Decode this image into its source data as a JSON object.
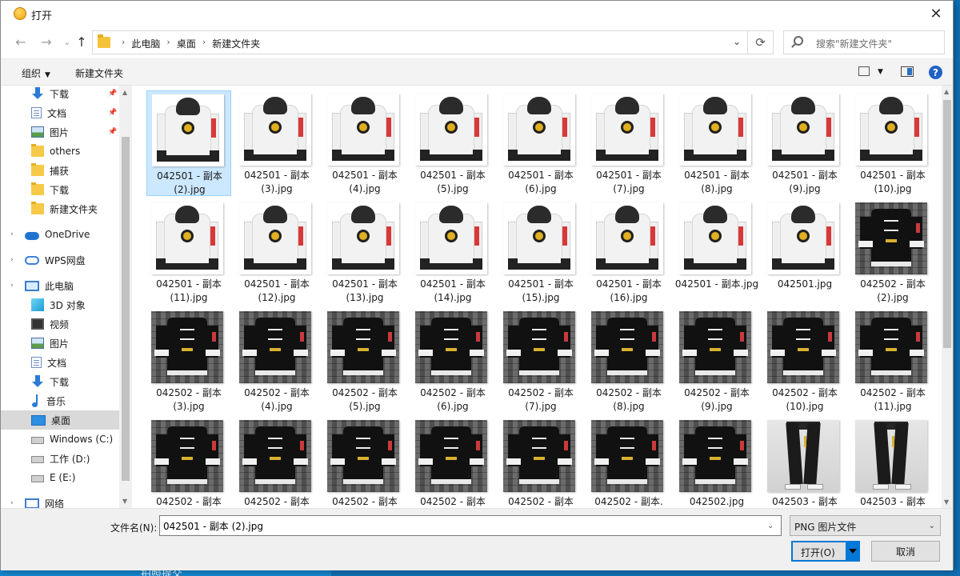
{
  "title": "打开",
  "nav": {
    "back": "←",
    "forward": "→",
    "up": "↑",
    "refresh": "⟳"
  },
  "breadcrumbs": [
    "此电脑",
    "桌面",
    "新建文件夹"
  ],
  "search": {
    "placeholder": "搜索\"新建文件夹\""
  },
  "toolbar": {
    "organize": "组织",
    "new_folder": "新建文件夹"
  },
  "sidebar": [
    {
      "label": "下载",
      "icon": "download-icon",
      "pinned": true
    },
    {
      "label": "文档",
      "icon": "document-icon",
      "pinned": true
    },
    {
      "label": "图片",
      "icon": "pictures-icon",
      "pinned": true
    },
    {
      "label": "others",
      "icon": "folder-icon",
      "pinned": false
    },
    {
      "label": "捕获",
      "icon": "folder-icon",
      "pinned": false
    },
    {
      "label": "下载",
      "icon": "folder-icon",
      "pinned": false
    },
    {
      "label": "新建文件夹",
      "icon": "folder-icon",
      "pinned": false
    },
    {
      "label": "OneDrive",
      "icon": "onedrive-icon",
      "pinned": false
    },
    {
      "label": "WPS网盘",
      "icon": "wps-cloud-icon",
      "pinned": false
    },
    {
      "label": "此电脑",
      "icon": "this-pc-icon",
      "pinned": false
    },
    {
      "label": "3D 对象",
      "icon": "3d-objects-icon",
      "pinned": false
    },
    {
      "label": "视频",
      "icon": "videos-icon",
      "pinned": false
    },
    {
      "label": "图片",
      "icon": "pictures-icon",
      "pinned": false
    },
    {
      "label": "文档",
      "icon": "document-icon",
      "pinned": false
    },
    {
      "label": "下载",
      "icon": "download-icon",
      "pinned": false
    },
    {
      "label": "音乐",
      "icon": "music-icon",
      "pinned": false
    },
    {
      "label": "桌面",
      "icon": "desktop-icon",
      "pinned": false,
      "selected": true
    },
    {
      "label": "Windows (C:)",
      "icon": "windows-drive-icon",
      "pinned": false
    },
    {
      "label": "工作 (D:)",
      "icon": "drive-icon",
      "pinned": false
    },
    {
      "label": "E (E:)",
      "icon": "drive-icon",
      "pinned": false
    },
    {
      "label": "网络",
      "icon": "network-icon",
      "pinned": false
    }
  ],
  "files": [
    {
      "label": "042501 - 副本 (2).jpg",
      "thumb": "white-hoodie",
      "selected": true
    },
    {
      "label": "042501 - 副本 (3).jpg",
      "thumb": "white-hoodie"
    },
    {
      "label": "042501 - 副本 (4).jpg",
      "thumb": "white-hoodie"
    },
    {
      "label": "042501 - 副本 (5).jpg",
      "thumb": "white-hoodie"
    },
    {
      "label": "042501 - 副本 (6).jpg",
      "thumb": "white-hoodie"
    },
    {
      "label": "042501 - 副本 (7).jpg",
      "thumb": "white-hoodie"
    },
    {
      "label": "042501 - 副本 (8).jpg",
      "thumb": "white-hoodie"
    },
    {
      "label": "042501 - 副本 (9).jpg",
      "thumb": "white-hoodie"
    },
    {
      "label": "042501 - 副本 (10).jpg",
      "thumb": "white-hoodie"
    },
    {
      "label": "042501 - 副本 (11).jpg",
      "thumb": "white-hoodie"
    },
    {
      "label": "042501 - 副本 (12).jpg",
      "thumb": "white-hoodie"
    },
    {
      "label": "042501 - 副本 (13).jpg",
      "thumb": "white-hoodie"
    },
    {
      "label": "042501 - 副本 (14).jpg",
      "thumb": "white-hoodie"
    },
    {
      "label": "042501 - 副本 (15).jpg",
      "thumb": "white-hoodie"
    },
    {
      "label": "042501 - 副本 (16).jpg",
      "thumb": "white-hoodie"
    },
    {
      "label": "042501 - 副本.jpg",
      "thumb": "white-hoodie"
    },
    {
      "label": "042501.jpg",
      "thumb": "white-hoodie"
    },
    {
      "label": "042502 - 副本 (2).jpg",
      "thumb": "black-tee"
    },
    {
      "label": "042502 - 副本 (3).jpg",
      "thumb": "black-tee"
    },
    {
      "label": "042502 - 副本 (4).jpg",
      "thumb": "black-tee"
    },
    {
      "label": "042502 - 副本 (5).jpg",
      "thumb": "black-tee"
    },
    {
      "label": "042502 - 副本 (6).jpg",
      "thumb": "black-tee"
    },
    {
      "label": "042502 - 副本 (7).jpg",
      "thumb": "black-tee"
    },
    {
      "label": "042502 - 副本 (8).jpg",
      "thumb": "black-tee"
    },
    {
      "label": "042502 - 副本 (9).jpg",
      "thumb": "black-tee"
    },
    {
      "label": "042502 - 副本 (10).jpg",
      "thumb": "black-tee"
    },
    {
      "label": "042502 - 副本 (11).jpg",
      "thumb": "black-tee"
    },
    {
      "label": "042502 - 副本",
      "thumb": "black-tee"
    },
    {
      "label": "042502 - 副本",
      "thumb": "black-tee"
    },
    {
      "label": "042502 - 副本",
      "thumb": "black-tee"
    },
    {
      "label": "042502 - 副本",
      "thumb": "black-tee"
    },
    {
      "label": "042502 - 副本",
      "thumb": "black-tee"
    },
    {
      "label": "042502 - 副本.",
      "thumb": "black-tee"
    },
    {
      "label": "042502.jpg",
      "thumb": "black-tee"
    },
    {
      "label": "042503 - 副本",
      "thumb": "black-pants"
    },
    {
      "label": "042503 - 副本",
      "thumb": "black-pants"
    }
  ],
  "bottom": {
    "filename_label": "文件名(N):",
    "filename_value": "042501 - 副本 (2).jpg",
    "filetype": "PNG 图片文件",
    "open_button": "打开(O)",
    "cancel_button": "取消"
  },
  "background_text": "拍照提交"
}
